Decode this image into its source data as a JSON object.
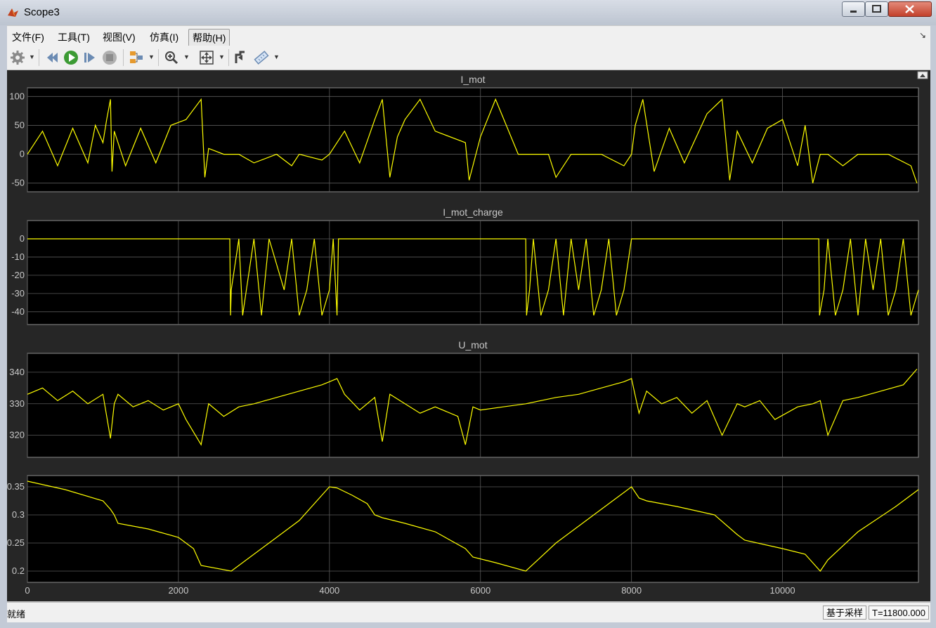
{
  "window": {
    "title": "Scope3"
  },
  "menu": {
    "items": [
      "文件(F)",
      "工具(T)",
      "视图(V)",
      "仿真(I)",
      "帮助(H)"
    ],
    "active_index": 4
  },
  "toolbar": {
    "buttons": [
      "gear-icon",
      "step-back-icon",
      "run-icon",
      "step-forward-icon",
      "stop-icon",
      "highlight-icon",
      "zoom-in-icon",
      "autoscale-icon",
      "signal-select-icon",
      "measure-icon"
    ]
  },
  "status": {
    "text": "就绪",
    "mode": "基于采样",
    "time": "T=11800.000"
  },
  "colors": {
    "signal": "#ffff00",
    "axes_bg": "#000000",
    "grid": "#5a5a5a",
    "panel_bg": "#262626",
    "label": "#c8c8c8"
  },
  "chart_data": [
    {
      "type": "line",
      "title": "I_mot",
      "xlim": [
        0,
        11800
      ],
      "ylim": [
        -65,
        115
      ],
      "yticks": [
        100,
        50,
        0,
        -50
      ],
      "xticks": [
        0,
        2000,
        4000,
        6000,
        8000,
        10000
      ],
      "grid": true,
      "series": [
        {
          "x": [
            0,
            200,
            400,
            600,
            800,
            900,
            1000,
            1050,
            1100,
            1120,
            1150,
            1300,
            1500,
            1700,
            1900,
            2100,
            2300,
            2350,
            2400,
            2600,
            2800,
            3000,
            3300,
            3500,
            3600,
            3900,
            4000,
            4200,
            4400,
            4600,
            4700,
            4800,
            4900,
            5000,
            5200,
            5400,
            5800,
            5850,
            6000,
            6200,
            6500,
            6900,
            7000,
            7200,
            7600,
            7900,
            8000,
            8050,
            8150,
            8300,
            8500,
            8700,
            9000,
            9200,
            9300,
            9400,
            9600,
            9800,
            10000,
            10200,
            10300,
            10400,
            10500,
            10600,
            10800,
            11000,
            11400,
            11700,
            11780
          ],
          "y": [
            0,
            40,
            -20,
            45,
            -15,
            50,
            20,
            60,
            95,
            -30,
            40,
            -20,
            45,
            -15,
            50,
            60,
            95,
            -40,
            10,
            0,
            0,
            -15,
            0,
            -20,
            0,
            -10,
            0,
            40,
            -15,
            60,
            95,
            -40,
            30,
            60,
            95,
            40,
            20,
            -45,
            30,
            95,
            0,
            0,
            -40,
            0,
            0,
            -20,
            0,
            50,
            95,
            -30,
            45,
            -15,
            70,
            95,
            -45,
            40,
            -15,
            45,
            60,
            -20,
            50,
            -50,
            0,
            0,
            -20,
            0,
            0,
            -20,
            -50
          ]
        }
      ]
    },
    {
      "type": "line",
      "title": "I_mot_charge",
      "xlim": [
        0,
        11800
      ],
      "ylim": [
        -47,
        10
      ],
      "yticks": [
        0,
        -10,
        -20,
        -30,
        -40
      ],
      "xticks": [
        0,
        2000,
        4000,
        6000,
        8000,
        10000
      ],
      "grid": true,
      "series": [
        {
          "x": [
            0,
            2680,
            2690,
            2700,
            2800,
            2850,
            2900,
            3000,
            3100,
            3200,
            3400,
            3500,
            3600,
            3700,
            3800,
            3900,
            4000,
            4050,
            4100,
            4120,
            6600,
            6610,
            6650,
            6700,
            6800,
            6900,
            7000,
            7100,
            7200,
            7300,
            7400,
            7500,
            7600,
            7700,
            7800,
            7900,
            8000,
            8050,
            10480,
            10490,
            10550,
            10600,
            10700,
            10800,
            10900,
            11000,
            11100,
            11200,
            11300,
            11400,
            11500,
            11600,
            11700,
            11800
          ],
          "y": [
            0,
            0,
            -42,
            -28,
            0,
            -42,
            -28,
            0,
            -42,
            0,
            -28,
            0,
            -42,
            -28,
            0,
            -42,
            -28,
            0,
            -42,
            0,
            0,
            -42,
            -28,
            0,
            -42,
            -28,
            0,
            -42,
            0,
            -28,
            0,
            -42,
            -28,
            0,
            -42,
            -28,
            0,
            0,
            0,
            -42,
            -28,
            0,
            -42,
            -28,
            0,
            -42,
            0,
            -28,
            0,
            -42,
            -28,
            0,
            -42,
            -28
          ]
        }
      ]
    },
    {
      "type": "line",
      "title": "U_mot",
      "xlim": [
        0,
        11800
      ],
      "ylim": [
        313,
        346
      ],
      "yticks": [
        340,
        330,
        320
      ],
      "xticks": [
        0,
        2000,
        4000,
        6000,
        8000,
        10000
      ],
      "grid": true,
      "series": [
        {
          "x": [
            0,
            200,
            400,
            600,
            800,
            1000,
            1100,
            1150,
            1200,
            1400,
            1600,
            1800,
            2000,
            2100,
            2300,
            2400,
            2600,
            2800,
            3000,
            3300,
            3600,
            3900,
            4000,
            4100,
            4200,
            4400,
            4600,
            4700,
            4800,
            5000,
            5200,
            5400,
            5700,
            5800,
            5900,
            6000,
            6300,
            6600,
            6800,
            7000,
            7300,
            7600,
            7900,
            8000,
            8100,
            8200,
            8400,
            8600,
            8800,
            9000,
            9200,
            9400,
            9500,
            9700,
            9900,
            10200,
            10400,
            10500,
            10600,
            10800,
            11000,
            11300,
            11600,
            11780
          ],
          "y": [
            333,
            335,
            331,
            334,
            330,
            333,
            319,
            330,
            333,
            329,
            331,
            328,
            330,
            325,
            317,
            330,
            326,
            329,
            330,
            332,
            334,
            336,
            337,
            338,
            333,
            328,
            332,
            318,
            333,
            330,
            327,
            329,
            326,
            317,
            329,
            328,
            329,
            330,
            331,
            332,
            333,
            335,
            337,
            338,
            327,
            334,
            330,
            332,
            327,
            331,
            320,
            330,
            329,
            331,
            325,
            329,
            330,
            331,
            320,
            331,
            332,
            334,
            336,
            341
          ]
        }
      ]
    },
    {
      "type": "line",
      "title": "",
      "xlim": [
        0,
        11800
      ],
      "ylim": [
        0.18,
        0.37
      ],
      "yticks": [
        0.35,
        0.3,
        0.25,
        0.2
      ],
      "xticks": [
        0,
        2000,
        4000,
        6000,
        8000,
        10000
      ],
      "grid": true,
      "series": [
        {
          "x": [
            0,
            500,
            1000,
            1100,
            1150,
            1200,
            1600,
            2000,
            2200,
            2300,
            2700,
            3200,
            3600,
            4000,
            4100,
            4300,
            4500,
            4600,
            4700,
            5000,
            5400,
            5800,
            5900,
            6200,
            6600,
            7000,
            7500,
            8000,
            8100,
            8200,
            8600,
            9100,
            9400,
            9500,
            10000,
            10300,
            10500,
            10600,
            11000,
            11500,
            11800
          ],
          "y": [
            0.36,
            0.345,
            0.325,
            0.31,
            0.3,
            0.285,
            0.275,
            0.26,
            0.24,
            0.21,
            0.2,
            0.25,
            0.29,
            0.35,
            0.348,
            0.335,
            0.32,
            0.3,
            0.295,
            0.285,
            0.27,
            0.24,
            0.225,
            0.215,
            0.2,
            0.25,
            0.3,
            0.35,
            0.33,
            0.325,
            0.315,
            0.3,
            0.265,
            0.255,
            0.24,
            0.23,
            0.2,
            0.22,
            0.27,
            0.315,
            0.345
          ]
        }
      ]
    }
  ]
}
